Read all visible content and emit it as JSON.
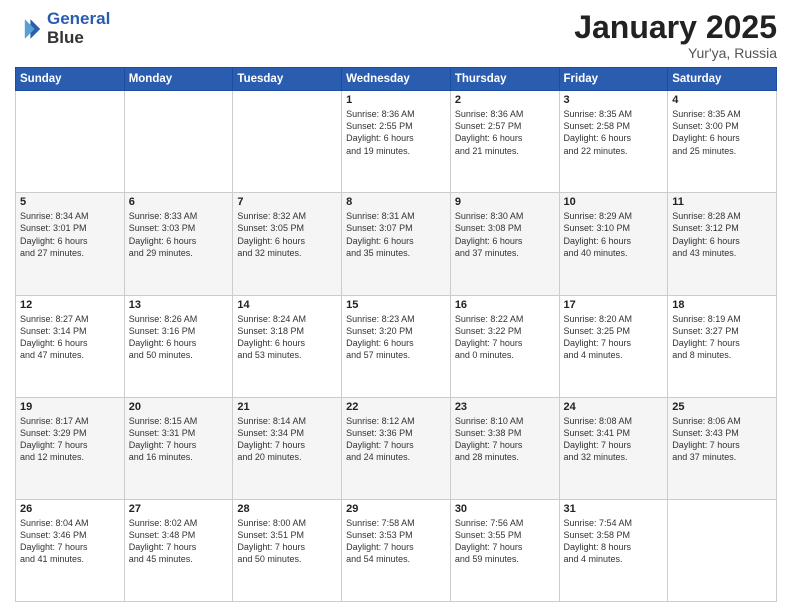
{
  "logo": {
    "line1": "General",
    "line2": "Blue"
  },
  "title": "January 2025",
  "subtitle": "Yur'ya, Russia",
  "days_header": [
    "Sunday",
    "Monday",
    "Tuesday",
    "Wednesday",
    "Thursday",
    "Friday",
    "Saturday"
  ],
  "weeks": [
    [
      {
        "day": "",
        "info": ""
      },
      {
        "day": "",
        "info": ""
      },
      {
        "day": "",
        "info": ""
      },
      {
        "day": "1",
        "info": "Sunrise: 8:36 AM\nSunset: 2:55 PM\nDaylight: 6 hours\nand 19 minutes."
      },
      {
        "day": "2",
        "info": "Sunrise: 8:36 AM\nSunset: 2:57 PM\nDaylight: 6 hours\nand 21 minutes."
      },
      {
        "day": "3",
        "info": "Sunrise: 8:35 AM\nSunset: 2:58 PM\nDaylight: 6 hours\nand 22 minutes."
      },
      {
        "day": "4",
        "info": "Sunrise: 8:35 AM\nSunset: 3:00 PM\nDaylight: 6 hours\nand 25 minutes."
      }
    ],
    [
      {
        "day": "5",
        "info": "Sunrise: 8:34 AM\nSunset: 3:01 PM\nDaylight: 6 hours\nand 27 minutes."
      },
      {
        "day": "6",
        "info": "Sunrise: 8:33 AM\nSunset: 3:03 PM\nDaylight: 6 hours\nand 29 minutes."
      },
      {
        "day": "7",
        "info": "Sunrise: 8:32 AM\nSunset: 3:05 PM\nDaylight: 6 hours\nand 32 minutes."
      },
      {
        "day": "8",
        "info": "Sunrise: 8:31 AM\nSunset: 3:07 PM\nDaylight: 6 hours\nand 35 minutes."
      },
      {
        "day": "9",
        "info": "Sunrise: 8:30 AM\nSunset: 3:08 PM\nDaylight: 6 hours\nand 37 minutes."
      },
      {
        "day": "10",
        "info": "Sunrise: 8:29 AM\nSunset: 3:10 PM\nDaylight: 6 hours\nand 40 minutes."
      },
      {
        "day": "11",
        "info": "Sunrise: 8:28 AM\nSunset: 3:12 PM\nDaylight: 6 hours\nand 43 minutes."
      }
    ],
    [
      {
        "day": "12",
        "info": "Sunrise: 8:27 AM\nSunset: 3:14 PM\nDaylight: 6 hours\nand 47 minutes."
      },
      {
        "day": "13",
        "info": "Sunrise: 8:26 AM\nSunset: 3:16 PM\nDaylight: 6 hours\nand 50 minutes."
      },
      {
        "day": "14",
        "info": "Sunrise: 8:24 AM\nSunset: 3:18 PM\nDaylight: 6 hours\nand 53 minutes."
      },
      {
        "day": "15",
        "info": "Sunrise: 8:23 AM\nSunset: 3:20 PM\nDaylight: 6 hours\nand 57 minutes."
      },
      {
        "day": "16",
        "info": "Sunrise: 8:22 AM\nSunset: 3:22 PM\nDaylight: 7 hours\nand 0 minutes."
      },
      {
        "day": "17",
        "info": "Sunrise: 8:20 AM\nSunset: 3:25 PM\nDaylight: 7 hours\nand 4 minutes."
      },
      {
        "day": "18",
        "info": "Sunrise: 8:19 AM\nSunset: 3:27 PM\nDaylight: 7 hours\nand 8 minutes."
      }
    ],
    [
      {
        "day": "19",
        "info": "Sunrise: 8:17 AM\nSunset: 3:29 PM\nDaylight: 7 hours\nand 12 minutes."
      },
      {
        "day": "20",
        "info": "Sunrise: 8:15 AM\nSunset: 3:31 PM\nDaylight: 7 hours\nand 16 minutes."
      },
      {
        "day": "21",
        "info": "Sunrise: 8:14 AM\nSunset: 3:34 PM\nDaylight: 7 hours\nand 20 minutes."
      },
      {
        "day": "22",
        "info": "Sunrise: 8:12 AM\nSunset: 3:36 PM\nDaylight: 7 hours\nand 24 minutes."
      },
      {
        "day": "23",
        "info": "Sunrise: 8:10 AM\nSunset: 3:38 PM\nDaylight: 7 hours\nand 28 minutes."
      },
      {
        "day": "24",
        "info": "Sunrise: 8:08 AM\nSunset: 3:41 PM\nDaylight: 7 hours\nand 32 minutes."
      },
      {
        "day": "25",
        "info": "Sunrise: 8:06 AM\nSunset: 3:43 PM\nDaylight: 7 hours\nand 37 minutes."
      }
    ],
    [
      {
        "day": "26",
        "info": "Sunrise: 8:04 AM\nSunset: 3:46 PM\nDaylight: 7 hours\nand 41 minutes."
      },
      {
        "day": "27",
        "info": "Sunrise: 8:02 AM\nSunset: 3:48 PM\nDaylight: 7 hours\nand 45 minutes."
      },
      {
        "day": "28",
        "info": "Sunrise: 8:00 AM\nSunset: 3:51 PM\nDaylight: 7 hours\nand 50 minutes."
      },
      {
        "day": "29",
        "info": "Sunrise: 7:58 AM\nSunset: 3:53 PM\nDaylight: 7 hours\nand 54 minutes."
      },
      {
        "day": "30",
        "info": "Sunrise: 7:56 AM\nSunset: 3:55 PM\nDaylight: 7 hours\nand 59 minutes."
      },
      {
        "day": "31",
        "info": "Sunrise: 7:54 AM\nSunset: 3:58 PM\nDaylight: 8 hours\nand 4 minutes."
      },
      {
        "day": "",
        "info": ""
      }
    ]
  ]
}
